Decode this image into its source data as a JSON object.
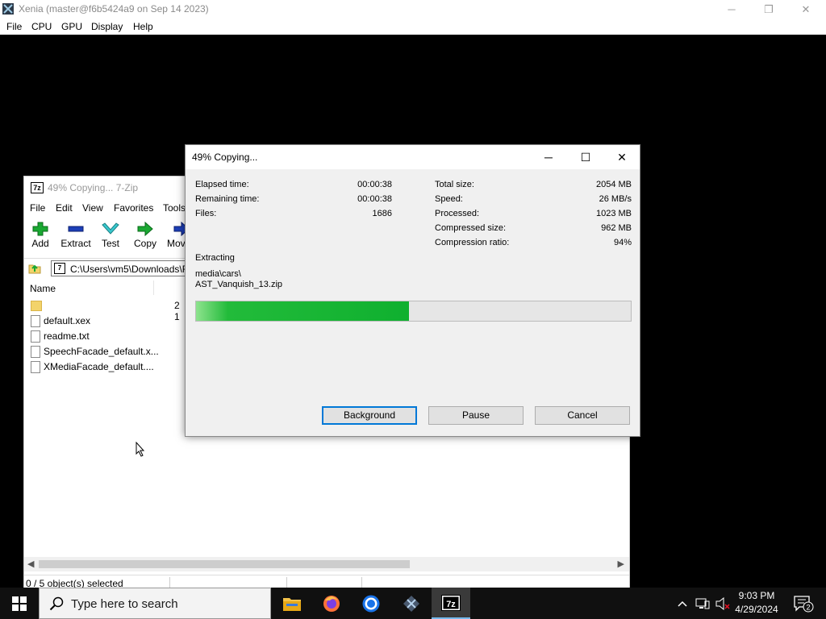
{
  "xenia": {
    "title": "Xenia (master@f6b5424a9 on Sep 14 2023)",
    "menu": [
      "File",
      "CPU",
      "GPU",
      "Display",
      "Help"
    ],
    "controls": {
      "minimize": "─",
      "restore": "❐",
      "close": "✕"
    }
  },
  "sevenzip": {
    "title": "49% Copying... 7-Zip",
    "menu": [
      "File",
      "Edit",
      "View",
      "Favorites",
      "Tools"
    ],
    "toolbar": [
      "Add",
      "Extract",
      "Test",
      "Copy",
      "Mov"
    ],
    "address": "C:\\Users\\vm5\\Downloads\\F",
    "column_name": "Name",
    "files": [
      {
        "name": "",
        "type": "folder",
        "size": "2 1"
      },
      {
        "name": "default.xex",
        "type": "file"
      },
      {
        "name": "readme.txt",
        "type": "text"
      },
      {
        "name": "SpeechFacade_default.x...",
        "type": "file"
      },
      {
        "name": "XMediaFacade_default....",
        "type": "file"
      }
    ],
    "status": "0 / 5 object(s) selected"
  },
  "dialog": {
    "title": "49% Copying...",
    "controls": {
      "minimize": "─",
      "maximize": "☐",
      "close": "✕"
    },
    "left_stats": [
      {
        "label": "Elapsed time:",
        "value": "00:00:38"
      },
      {
        "label": "Remaining time:",
        "value": "00:00:38"
      },
      {
        "label": "Files:",
        "value": "1686"
      }
    ],
    "right_stats": [
      {
        "label": "Total size:",
        "value": "2054 MB"
      },
      {
        "label": "Speed:",
        "value": "26 MB/s"
      },
      {
        "label": "Processed:",
        "value": "1023 MB"
      },
      {
        "label": "Compressed size:",
        "value": "962 MB"
      },
      {
        "label": "Compression ratio:",
        "value": "94%"
      }
    ],
    "operation": "Extracting",
    "path_line1": "media\\cars\\",
    "path_line2": "AST_Vanquish_13.zip",
    "progress_percent": 49,
    "buttons": {
      "background": "Background",
      "pause": "Pause",
      "cancel": "Cancel"
    }
  },
  "taskbar": {
    "search_placeholder": "Type here to search",
    "time": "9:03 PM",
    "date": "4/29/2024",
    "notification_count": "2",
    "apps": [
      "file-explorer",
      "firefox",
      "chrome",
      "xenia",
      "7-zip"
    ]
  },
  "colors": {
    "progress": "#0fb02f",
    "accent": "#0078d7",
    "taskbar": "#101010"
  }
}
